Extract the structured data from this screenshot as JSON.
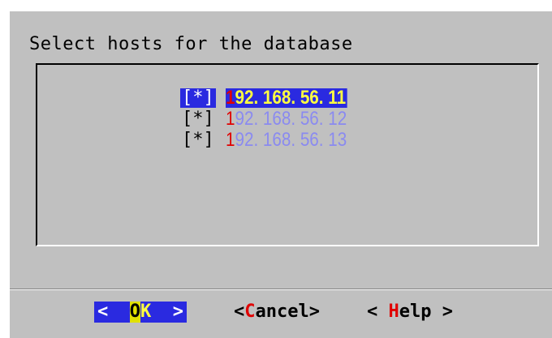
{
  "dialog": {
    "title": "Select hosts for the database"
  },
  "hosts": [
    {
      "checkbox": "[*]",
      "hotkey": "1",
      "rest": "92. 168. 56. 11",
      "checked": true,
      "selected": true
    },
    {
      "checkbox": "[*]",
      "hotkey": "1",
      "rest": "92. 168. 56. 12",
      "checked": true,
      "selected": false
    },
    {
      "checkbox": "[*]",
      "hotkey": "1",
      "rest": "92. 168. 56. 13",
      "checked": true,
      "selected": false
    }
  ],
  "buttons": {
    "ok": {
      "left_arrow": "<",
      "o": "O",
      "k": "K",
      "right_arrow": ">"
    },
    "cancel": {
      "open": "<",
      "hotkey": "C",
      "rest": "ancel",
      "close": ">"
    },
    "help": {
      "open": "< ",
      "hotkey": "H",
      "rest": "elp",
      "close": " >"
    }
  },
  "colors": {
    "dialog_bg": "#c0c0c0",
    "selection_bg": "#2a2ae0",
    "selected_text": "#ffff40",
    "unselected_text": "#8a8af0",
    "hotkey": "#e00000"
  }
}
